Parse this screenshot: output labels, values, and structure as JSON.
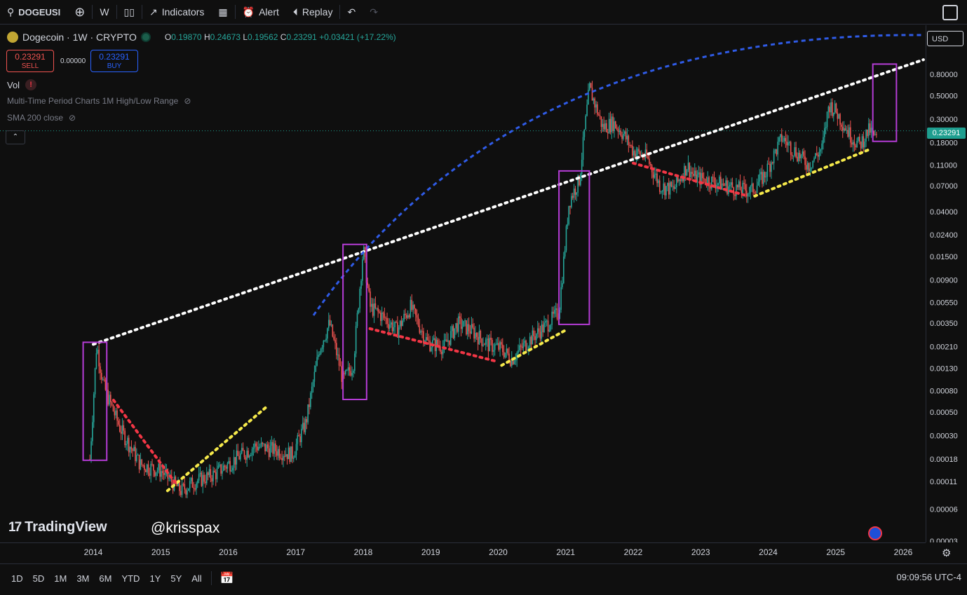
{
  "toolbar": {
    "symbol": "DOGEUSI",
    "interval": "W",
    "indicators": "Indicators",
    "alert": "Alert",
    "replay": "Replay"
  },
  "legend": {
    "title": "Dogecoin · 1W · CRYPTO",
    "o_label": "O",
    "o": "0.19870",
    "h_label": "H",
    "h": "0.24673",
    "l_label": "L",
    "l": "0.19562",
    "c_label": "C",
    "c": "0.23291",
    "change": "+0.03421 (+17.22%)"
  },
  "trade": {
    "sell_price": "0.23291",
    "sell_label": "SELL",
    "spread": "0.00000",
    "buy_price": "0.23291",
    "buy_label": "BUY"
  },
  "indicators": [
    "Vol",
    "Multi-Time Period Charts 1M High/Low Range",
    "SMA 200 close"
  ],
  "currency": "USD",
  "last_price": "0.23291",
  "watermark": "@krisspax",
  "brand": "TradingView",
  "ranges": [
    "1D",
    "5D",
    "1M",
    "3M",
    "6M",
    "YTD",
    "1Y",
    "5Y",
    "All"
  ],
  "clock": "09:09:56 UTC-4",
  "colors": {
    "up": "#26a69a",
    "down": "#ef5350",
    "blue": "#2f5be6",
    "magenta": "#b53cd6",
    "yellow": "#f5e94a",
    "red": "#f23645",
    "white": "#ffffff"
  },
  "chart_data": {
    "type": "candlestick",
    "title": "Dogecoin · 1W · CRYPTO",
    "scale": "log",
    "x_ticks": [
      "2014",
      "2015",
      "2016",
      "2017",
      "2018",
      "2019",
      "2020",
      "2021",
      "2022",
      "2023",
      "2024",
      "2025",
      "2026"
    ],
    "y_ticks": [
      "0.00003",
      "0.00006",
      "0.00011",
      "0.00018",
      "0.00030",
      "0.00050",
      "0.00080",
      "0.00130",
      "0.00210",
      "0.00350",
      "0.00550",
      "0.00900",
      "0.01500",
      "0.02400",
      "0.04000",
      "0.07000",
      "0.11000",
      "0.18000",
      "0.30000",
      "0.50000",
      "0.80000"
    ],
    "price_path": [
      [
        2013.95,
        0.00018
      ],
      [
        2014.05,
        0.0022
      ],
      [
        2014.15,
        0.0009
      ],
      [
        2014.4,
        0.00035
      ],
      [
        2014.7,
        0.00016
      ],
      [
        2015.0,
        0.00014
      ],
      [
        2015.3,
        9e-05
      ],
      [
        2015.5,
        0.00011
      ],
      [
        2015.8,
        0.00013
      ],
      [
        2016.1,
        0.00018
      ],
      [
        2016.4,
        0.00024
      ],
      [
        2016.7,
        0.00022
      ],
      [
        2016.95,
        0.0002
      ],
      [
        2017.15,
        0.0004
      ],
      [
        2017.35,
        0.002
      ],
      [
        2017.5,
        0.0035
      ],
      [
        2017.7,
        0.001
      ],
      [
        2017.85,
        0.0014
      ],
      [
        2018.0,
        0.018
      ],
      [
        2018.1,
        0.005
      ],
      [
        2018.3,
        0.004
      ],
      [
        2018.5,
        0.003
      ],
      [
        2018.7,
        0.005
      ],
      [
        2018.95,
        0.0023
      ],
      [
        2019.2,
        0.0021
      ],
      [
        2019.4,
        0.0035
      ],
      [
        2019.6,
        0.003
      ],
      [
        2019.85,
        0.0022
      ],
      [
        2020.05,
        0.002
      ],
      [
        2020.2,
        0.0016
      ],
      [
        2020.45,
        0.0024
      ],
      [
        2020.7,
        0.0033
      ],
      [
        2020.9,
        0.0045
      ],
      [
        2021.05,
        0.05
      ],
      [
        2021.2,
        0.08
      ],
      [
        2021.35,
        0.6
      ],
      [
        2021.55,
        0.25
      ],
      [
        2021.7,
        0.28
      ],
      [
        2021.85,
        0.22
      ],
      [
        2022.0,
        0.15
      ],
      [
        2022.2,
        0.13
      ],
      [
        2022.4,
        0.07
      ],
      [
        2022.6,
        0.065
      ],
      [
        2022.8,
        0.11
      ],
      [
        2022.9,
        0.085
      ],
      [
        2023.1,
        0.08
      ],
      [
        2023.4,
        0.07
      ],
      [
        2023.6,
        0.065
      ],
      [
        2023.75,
        0.063
      ],
      [
        2023.95,
        0.09
      ],
      [
        2024.2,
        0.2
      ],
      [
        2024.4,
        0.15
      ],
      [
        2024.6,
        0.11
      ],
      [
        2024.8,
        0.16
      ],
      [
        2024.9,
        0.42
      ],
      [
        2025.0,
        0.36
      ],
      [
        2025.2,
        0.22
      ],
      [
        2025.35,
        0.17
      ],
      [
        2025.5,
        0.24
      ],
      [
        2025.6,
        0.19
      ],
      [
        2025.62,
        0.23291
      ]
    ],
    "last_price": 0.23291,
    "annotations": {
      "white_trendline": [
        [
          2014.0,
          0.0022
        ],
        [
          2026.3,
          1.1
        ]
      ],
      "blue_arc": "arc from 2017.3 to 2026.3, peaking near 1.9",
      "boxes": [
        {
          "x": [
            2013.85,
            2014.2
          ],
          "y": [
            0.000175,
            0.0023
          ]
        },
        {
          "x": [
            2017.7,
            2018.05
          ],
          "y": [
            0.00066,
            0.0195
          ]
        },
        {
          "x": [
            2020.9,
            2021.35
          ],
          "y": [
            0.0034,
            0.097
          ]
        },
        {
          "x": [
            2025.55,
            2025.9
          ],
          "y": [
            0.185,
            1.0
          ]
        }
      ],
      "yellow_support": [
        [
          [
            2015.1,
            9e-05
          ],
          [
            2016.55,
            0.00055
          ]
        ],
        [
          [
            2020.05,
            0.00139
          ],
          [
            2021.0,
            0.003
          ]
        ],
        [
          [
            2023.8,
            0.056
          ],
          [
            2025.5,
            0.155
          ]
        ]
      ],
      "red_resistance": [
        [
          [
            2014.3,
            0.00065
          ],
          [
            2015.25,
            0.0001
          ]
        ],
        [
          [
            2018.1,
            0.0031
          ],
          [
            2020.0,
            0.0015
          ]
        ],
        [
          [
            2022.0,
            0.115
          ],
          [
            2023.7,
            0.056
          ]
        ]
      ]
    }
  }
}
